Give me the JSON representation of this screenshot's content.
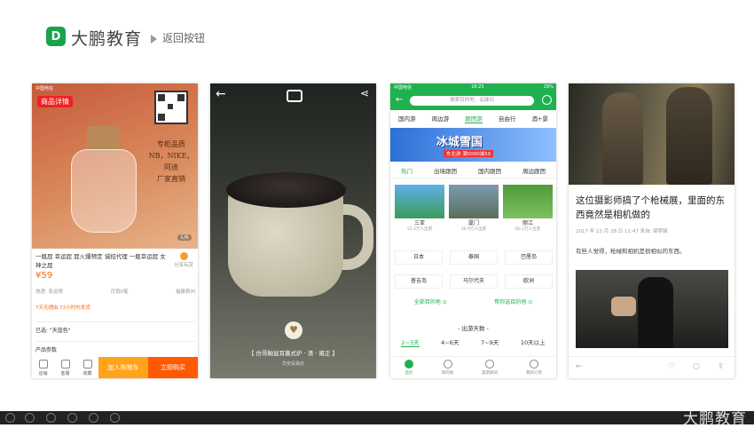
{
  "header": {
    "logo_letter": "D",
    "brand": "大鹏教育",
    "back_label": "返回按钮"
  },
  "panel1": {
    "status": "中国电信",
    "tag": "商品详情",
    "slogan_lines": [
      "专柜品质",
      "NB，NIKE，阿迪",
      "厂家直销"
    ],
    "page_indicator": "1/6",
    "description": "一瓶屁 幸运屁 屁火爆预定 诚招代理 一瓶幸运屁 女神之屁",
    "share": "分享有赏",
    "price": "¥59",
    "meta": [
      "快递: 免运费",
      "月销0笔",
      "福建泉州"
    ],
    "services": "7天无理由  72小时内发货",
    "selected": "已选: \"天蓝色\"",
    "params": "产品参数",
    "bottom_icons": [
      "店铺",
      "客服",
      "收藏"
    ],
    "cart_button": "加入购物车",
    "buy_button": "立即购买"
  },
  "panel2": {
    "caption": "【 仿哥釉鼠耳簋式炉 · 清 · 雍正 】",
    "subcaption": "华安贸易处"
  },
  "panel3": {
    "status_left": "中国电信",
    "status_time": "16:25",
    "status_right": "29%",
    "search_placeholder": "搜索目的地、关键词",
    "tabs": [
      "国内游",
      "周边游",
      "跟团游",
      "自由行",
      "酒+景"
    ],
    "active_tab": 2,
    "banner_title": "冰城雪国",
    "banner_sub": "东北游 满5000减50",
    "subtabs": [
      "热门",
      "出境跟团",
      "国内跟团",
      "周边跟团"
    ],
    "active_subtab": 0,
    "featured": [
      {
        "name": "三亚",
        "count": "55.2万人出游"
      },
      {
        "name": "厦门",
        "count": "56.9万人出游"
      },
      {
        "name": "丽江",
        "count": "60.1万人出游"
      }
    ],
    "grid_row1": [
      "日本",
      "泰国",
      "巴厘岛"
    ],
    "grid_row2": [
      "普吉岛",
      "马尔代夫",
      "欧洲"
    ],
    "links": [
      "全部目的地 ⊙",
      "帮你选目的地 ⊙"
    ],
    "days_title": "- 出游天数 -",
    "day_options": [
      "2~3天",
      "4~6天",
      "7~9天",
      "10天以上"
    ],
    "active_day": 0,
    "nav": [
      "首页",
      "目的地",
      "旅游顾问",
      "我的订单"
    ]
  },
  "panel4": {
    "title": "这位摄影师搞了个枪械展，里面的东西竟然是相机做的",
    "date": "2017 年 12 月 28 日 11:47  来自: 梁梦颖",
    "text": "有些人觉得，枪械和相机是很相似的东西。",
    "bar_icons": [
      "←",
      "♡",
      "○",
      "⇪"
    ]
  },
  "footer": {
    "watermark": "大鹏教育"
  }
}
